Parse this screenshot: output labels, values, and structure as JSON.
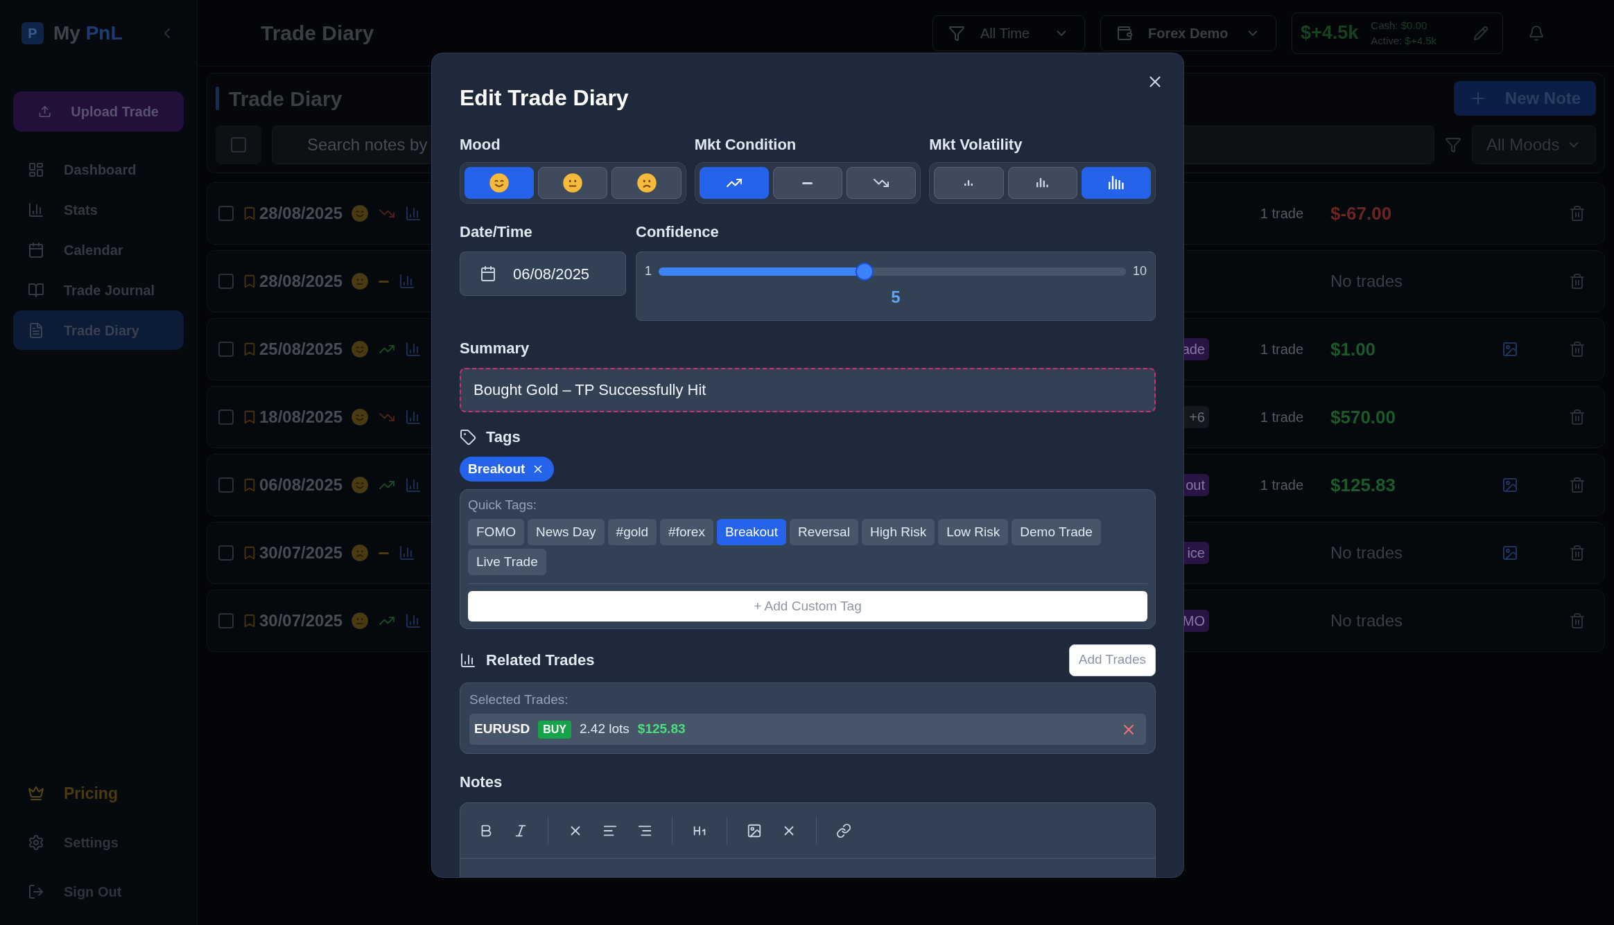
{
  "sidebar": {
    "logo": {
      "mark": "P",
      "first": "My",
      "second": "PnL"
    },
    "upload_button": "Upload Trade",
    "nav": [
      {
        "label": "Dashboard",
        "kind": "dashboard",
        "selected": false
      },
      {
        "label": "Stats",
        "kind": "stats",
        "selected": false
      },
      {
        "label": "Calendar",
        "kind": "calendar",
        "selected": false
      },
      {
        "label": "Trade Journal",
        "kind": "journal",
        "selected": false
      },
      {
        "label": "Trade Diary",
        "kind": "diary",
        "selected": true
      }
    ],
    "footer": [
      {
        "label": "Pricing",
        "kind": "pricing"
      },
      {
        "label": "Settings",
        "kind": "settings"
      },
      {
        "label": "Sign Out",
        "kind": "signout"
      }
    ]
  },
  "top_bar": {
    "title": "Trade Diary",
    "period": "All Time",
    "account": "Forex Demo",
    "pnl": "$+4.5k",
    "cash_label": "Cash:",
    "cash_value": "$0.00",
    "active_label": "Active:",
    "active_value": "$+4.5k"
  },
  "diary": {
    "title": "Trade Diary",
    "new_note": "New Note",
    "select_all_checked": false,
    "search_placeholder": "Search notes by",
    "mood_filter": "All Moods",
    "entries": [
      {
        "checked": false,
        "date": "28/08/2025",
        "mood": {
          "kind": "happy"
        },
        "trend": {
          "kind": "down"
        },
        "trades": "1 trade",
        "result": {
          "text": "$-67.00",
          "kind": "loss"
        },
        "has_image": false
      },
      {
        "checked": false,
        "date": "28/08/2025",
        "mood": {
          "kind": "neutral"
        },
        "trend": {
          "kind": "flat"
        },
        "result": {
          "text": "No trades",
          "kind": "empty"
        },
        "has_image": false
      },
      {
        "checked": false,
        "date": "25/08/2025",
        "mood": {
          "kind": "happy"
        },
        "trend": {
          "kind": "up"
        },
        "tag": {
          "text": "ade",
          "kind": "label"
        },
        "trades": "1 trade",
        "result": {
          "text": "$1.00",
          "kind": "profit"
        },
        "has_image": true
      },
      {
        "checked": false,
        "date": "18/08/2025",
        "mood": {
          "kind": "happy"
        },
        "trend": {
          "kind": "down"
        },
        "tag": {
          "text": "+6",
          "kind": "count"
        },
        "trades": "1 trade",
        "result": {
          "text": "$570.00",
          "kind": "profit"
        },
        "has_image": false
      },
      {
        "checked": false,
        "date": "06/08/2025",
        "mood": {
          "kind": "happy"
        },
        "trend": {
          "kind": "up"
        },
        "tag": {
          "text": "out",
          "kind": "label"
        },
        "trades": "1 trade",
        "result": {
          "text": "$125.83",
          "kind": "profit"
        },
        "has_image": true
      },
      {
        "checked": false,
        "date": "30/07/2025",
        "mood": {
          "kind": "sad"
        },
        "trend": {
          "kind": "flat"
        },
        "tag": {
          "text": "ice",
          "kind": "label"
        },
        "result": {
          "text": "No trades",
          "kind": "empty"
        },
        "has_image": true
      },
      {
        "checked": false,
        "date": "30/07/2025",
        "mood": {
          "kind": "neutral"
        },
        "trend": {
          "kind": "up"
        },
        "tag": {
          "text": "MO",
          "kind": "label"
        },
        "result": {
          "text": "No trades",
          "kind": "empty"
        },
        "has_image": false
      }
    ]
  },
  "modal": {
    "title": "Edit Trade Diary",
    "mood": {
      "label": "Mood",
      "options": [
        {
          "kind": "happy",
          "selected": true
        },
        {
          "kind": "neutral",
          "selected": false
        },
        {
          "kind": "sad",
          "selected": false
        }
      ]
    },
    "market_condition": {
      "label": "Mkt Condition",
      "options": [
        {
          "kind": "up",
          "selected": true
        },
        {
          "kind": "flat",
          "selected": false
        },
        {
          "kind": "down",
          "selected": false
        }
      ]
    },
    "market_volatility": {
      "label": "Mkt Volatility",
      "options": [
        {
          "kind": "low",
          "selected": false
        },
        {
          "kind": "medium",
          "selected": false
        },
        {
          "kind": "high",
          "selected": true
        }
      ]
    },
    "date": {
      "label": "Date/Time",
      "value": "06/08/2025"
    },
    "confidence": {
      "label": "Confidence",
      "min": "1",
      "max": "10",
      "value": "5",
      "level": 0.44
    },
    "summary": {
      "label": "Summary",
      "value": "Bought Gold – TP Successfully Hit"
    },
    "tags": {
      "label": "Tags",
      "chosen": [
        "Breakout"
      ],
      "quick_label": "Quick Tags:",
      "quick": [
        {
          "label": "FOMO",
          "selected": false
        },
        {
          "label": "News Day",
          "selected": false
        },
        {
          "label": "#gold",
          "selected": false
        },
        {
          "label": "#forex",
          "selected": false
        },
        {
          "label": "Breakout",
          "selected": true
        },
        {
          "label": "Reversal",
          "selected": false
        },
        {
          "label": "High Risk",
          "selected": false
        },
        {
          "label": "Low Risk",
          "selected": false
        },
        {
          "label": "Demo Trade",
          "selected": false
        },
        {
          "label": "Live Trade",
          "selected": false
        }
      ],
      "custom_placeholder": "+ Add Custom Tag"
    },
    "related": {
      "label": "Related Trades",
      "add_button": "Add Trades",
      "selected_label": "Selected Trades:",
      "trades": [
        {
          "symbol": "EURUSD",
          "side": "BUY",
          "lots": "2.42 lots",
          "pnl": "$125.83"
        }
      ]
    },
    "notes": {
      "label": "Notes",
      "toolbar": [
        {
          "kind": "bold"
        },
        {
          "kind": "italic"
        },
        {
          "kind": "divider"
        },
        {
          "kind": "clear"
        },
        {
          "kind": "align-left"
        },
        {
          "kind": "align-right"
        },
        {
          "kind": "divider"
        },
        {
          "kind": "heading"
        },
        {
          "kind": "divider"
        },
        {
          "kind": "image"
        },
        {
          "kind": "clear"
        },
        {
          "kind": "divider"
        },
        {
          "kind": "link"
        }
      ]
    }
  }
}
